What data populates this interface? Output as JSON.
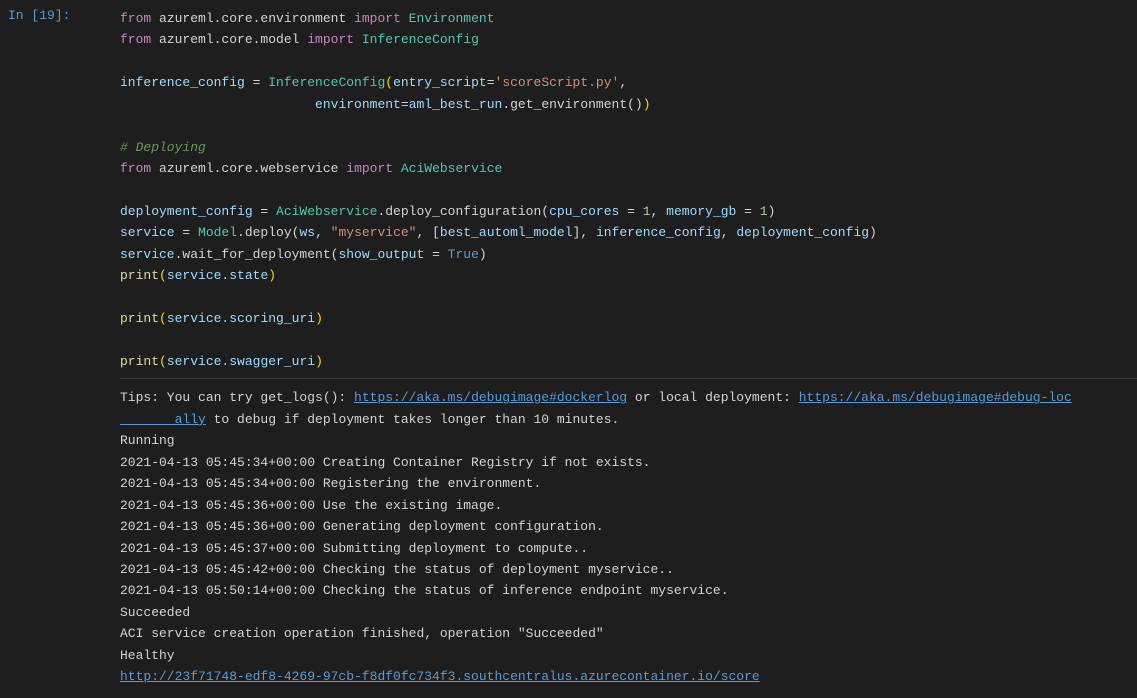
{
  "cell": {
    "label": "In [19]:",
    "code_lines": [
      {
        "id": "line1",
        "parts": [
          {
            "text": "from",
            "cls": "kw-from"
          },
          {
            "text": " azureml.core.environment ",
            "cls": "normal"
          },
          {
            "text": "import",
            "cls": "kw-import"
          },
          {
            "text": " Environment",
            "cls": "classname"
          }
        ]
      },
      {
        "id": "line2",
        "parts": [
          {
            "text": "from",
            "cls": "kw-from"
          },
          {
            "text": " azureml.core.model ",
            "cls": "normal"
          },
          {
            "text": "import",
            "cls": "kw-import"
          },
          {
            "text": " InferenceConfig",
            "cls": "classname"
          }
        ]
      },
      {
        "id": "blank1",
        "parts": [
          {
            "text": "",
            "cls": "normal"
          }
        ]
      },
      {
        "id": "line3",
        "parts": [
          {
            "text": "inference_config",
            "cls": "var"
          },
          {
            "text": " = ",
            "cls": "normal"
          },
          {
            "text": "InferenceConfig",
            "cls": "classname"
          },
          {
            "text": "(",
            "cls": "paren"
          },
          {
            "text": "entry_script",
            "cls": "param"
          },
          {
            "text": "=",
            "cls": "normal"
          },
          {
            "text": "'scoreScript.py'",
            "cls": "string"
          },
          {
            "text": ",",
            "cls": "normal"
          }
        ]
      },
      {
        "id": "line4",
        "parts": [
          {
            "text": "                         environment",
            "cls": "param"
          },
          {
            "text": "=",
            "cls": "normal"
          },
          {
            "text": "aml_best_run",
            "cls": "var"
          },
          {
            "text": ".get_environment()",
            "cls": "normal"
          },
          {
            "text": ")",
            "cls": "paren"
          }
        ]
      },
      {
        "id": "blank2",
        "parts": [
          {
            "text": "",
            "cls": "normal"
          }
        ]
      },
      {
        "id": "line5",
        "parts": [
          {
            "text": "# Deploying",
            "cls": "comment"
          }
        ]
      },
      {
        "id": "line6",
        "parts": [
          {
            "text": "from",
            "cls": "kw-from"
          },
          {
            "text": " azureml.core.webservice ",
            "cls": "normal"
          },
          {
            "text": "import",
            "cls": "kw-import"
          },
          {
            "text": " AciWebservice",
            "cls": "classname"
          }
        ]
      },
      {
        "id": "blank3",
        "parts": [
          {
            "text": "",
            "cls": "normal"
          }
        ]
      },
      {
        "id": "line7",
        "parts": [
          {
            "text": "deployment_config",
            "cls": "var"
          },
          {
            "text": " = ",
            "cls": "normal"
          },
          {
            "text": "AciWebservice",
            "cls": "classname"
          },
          {
            "text": ".deploy_configuration(",
            "cls": "normal"
          },
          {
            "text": "cpu_cores",
            "cls": "param"
          },
          {
            "text": " = ",
            "cls": "normal"
          },
          {
            "text": "1",
            "cls": "number"
          },
          {
            "text": ", ",
            "cls": "normal"
          },
          {
            "text": "memory_gb",
            "cls": "param"
          },
          {
            "text": " = ",
            "cls": "normal"
          },
          {
            "text": "1",
            "cls": "number"
          },
          {
            "text": ")",
            "cls": "normal"
          }
        ]
      },
      {
        "id": "line8",
        "parts": [
          {
            "text": "service",
            "cls": "var"
          },
          {
            "text": " = ",
            "cls": "normal"
          },
          {
            "text": "Model",
            "cls": "classname"
          },
          {
            "text": ".deploy(",
            "cls": "normal"
          },
          {
            "text": "ws",
            "cls": "var"
          },
          {
            "text": ", ",
            "cls": "normal"
          },
          {
            "text": "\"myservice\"",
            "cls": "string"
          },
          {
            "text": ", [",
            "cls": "normal"
          },
          {
            "text": "best_automl_model",
            "cls": "var"
          },
          {
            "text": "], ",
            "cls": "normal"
          },
          {
            "text": "inference_config",
            "cls": "var"
          },
          {
            "text": ", ",
            "cls": "normal"
          },
          {
            "text": "deployment_config",
            "cls": "var"
          },
          {
            "text": ")",
            "cls": "normal"
          }
        ]
      },
      {
        "id": "line9",
        "parts": [
          {
            "text": "service",
            "cls": "var"
          },
          {
            "text": ".wait_for_deployment(",
            "cls": "normal"
          },
          {
            "text": "show_output",
            "cls": "param"
          },
          {
            "text": " = ",
            "cls": "normal"
          },
          {
            "text": "True",
            "cls": "kw-true"
          },
          {
            "text": ")",
            "cls": "normal"
          }
        ]
      },
      {
        "id": "line10",
        "parts": [
          {
            "text": "print",
            "cls": "funcname"
          },
          {
            "text": "(",
            "cls": "paren"
          },
          {
            "text": "service.state",
            "cls": "var"
          },
          {
            "text": ")",
            "cls": "paren"
          }
        ]
      },
      {
        "id": "blank4",
        "parts": [
          {
            "text": "",
            "cls": "normal"
          }
        ]
      },
      {
        "id": "line11",
        "parts": [
          {
            "text": "print",
            "cls": "funcname"
          },
          {
            "text": "(",
            "cls": "paren"
          },
          {
            "text": "service.scoring_uri",
            "cls": "var"
          },
          {
            "text": ")",
            "cls": "paren"
          }
        ]
      },
      {
        "id": "blank5",
        "parts": [
          {
            "text": "",
            "cls": "normal"
          }
        ]
      },
      {
        "id": "line12",
        "parts": [
          {
            "text": "print",
            "cls": "funcname"
          },
          {
            "text": "(",
            "cls": "paren"
          },
          {
            "text": "service.swagger_uri",
            "cls": "var"
          },
          {
            "text": ")",
            "cls": "paren"
          }
        ]
      }
    ],
    "output": {
      "tip_prefix": "Tips: You can try get_logs(): ",
      "tip_link1": "https://aka.ms/debugimage#dockerlog",
      "tip_mid": " or local deployment: ",
      "tip_link2": "https://aka.ms/debugimage#debug-locally",
      "tip_suffix": " to debug if deployment takes longer than 10 minutes.",
      "lines": [
        "Running",
        "2021-04-13 05:45:34+00:00 Creating Container Registry if not exists.",
        "2021-04-13 05:45:34+00:00 Registering the environment.",
        "2021-04-13 05:45:36+00:00 Use the existing image.",
        "2021-04-13 05:45:36+00:00 Generating deployment configuration.",
        "2021-04-13 05:45:37+00:00 Submitting deployment to compute..",
        "2021-04-13 05:45:42+00:00 Checking the status of deployment myservice..",
        "2021-04-13 05:50:14+00:00 Checking the status of inference endpoint myservice.",
        "Succeeded",
        "ACI service creation operation finished, operation \"Succeeded\"",
        "Healthy"
      ],
      "final_link": "http://23f71748-edf8-4269-97cb-f8df0fc734f3.southcentralus.azurecontainer.io/score"
    }
  }
}
